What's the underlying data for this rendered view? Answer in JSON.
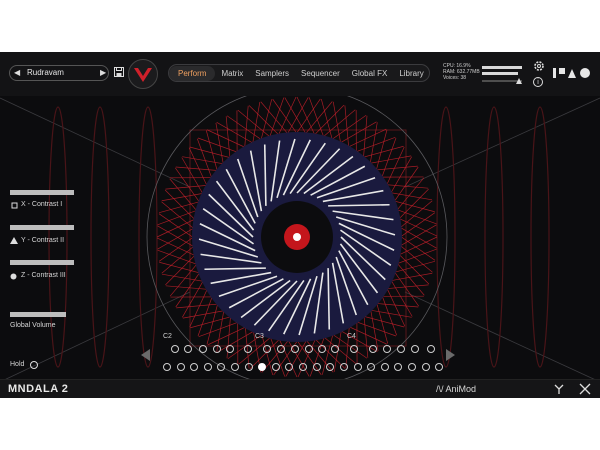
{
  "header": {
    "preset_name": "Rudravam",
    "prev_arrow": "◀",
    "next_arrow": "▶",
    "tabs": [
      "Perform",
      "Matrix",
      "Samplers",
      "Sequencer",
      "Global FX",
      "Library"
    ],
    "active_tab": "Perform",
    "cpu": "CPU: 16.9%",
    "ram": "RAM: 632.77MB",
    "voices": "Voices: 38",
    "info_label": "i"
  },
  "controls": {
    "x_contrast": {
      "label": "X - Contrast I",
      "level": 0.8
    },
    "y_contrast": {
      "label": "Y - Contrast II",
      "level": 0.8
    },
    "z_contrast": {
      "label": "Z - Contrast III",
      "level": 0.8
    },
    "global_volume": {
      "label": "Global Volume",
      "level": 0.7
    },
    "hold": {
      "label": "Hold"
    }
  },
  "keyboard": {
    "octave_labels": [
      "C2",
      "C3",
      "C4"
    ],
    "active_key_index": 7
  },
  "footer": {
    "brand": "MNDALA 2",
    "product": "/\\/ AniMod"
  },
  "colors": {
    "accent": "#f0a060",
    "web_red": "#c0202a",
    "inner_fill": "#1a1a3e"
  }
}
